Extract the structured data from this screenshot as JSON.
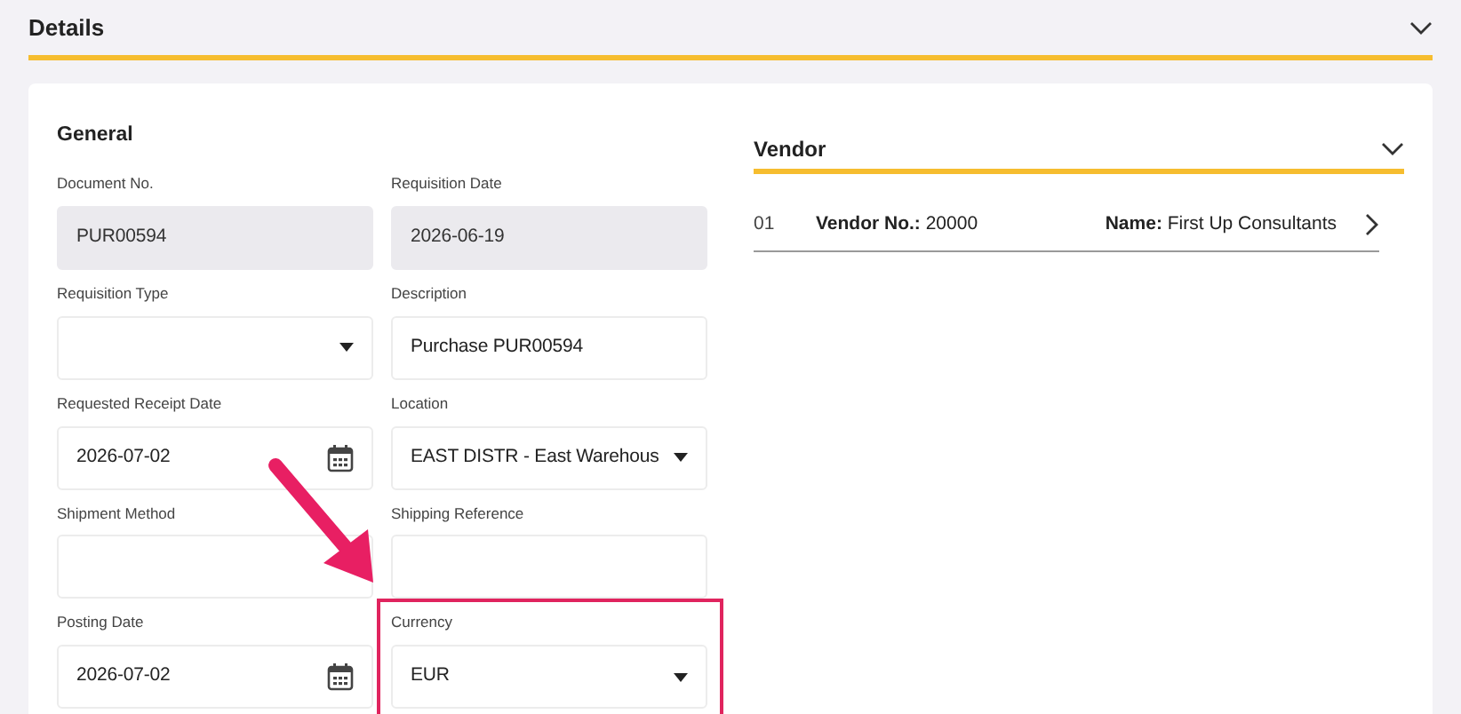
{
  "section": {
    "title": "Details",
    "expanded": true
  },
  "general": {
    "title": "General",
    "fields": [
      {
        "label": "Document No.",
        "kind": "readonly",
        "value": "PUR00594"
      },
      {
        "label": "Requisition Date",
        "kind": "readonly",
        "value": "2026-06-19"
      },
      {
        "label": "Requisition Type",
        "kind": "select"
      },
      {
        "label": "Description",
        "kind": "text",
        "value": "Purchase PUR00594"
      },
      {
        "label": "Requested Receipt Date",
        "kind": "date",
        "value": "2026-07-02"
      },
      {
        "label": "Location",
        "kind": "select",
        "value": "EAST DISTR - East Warehous"
      },
      {
        "label": "Shipment Method",
        "kind": "text"
      },
      {
        "label": "Shipping Reference",
        "kind": "text"
      },
      {
        "label": "Posting Date",
        "kind": "date",
        "value": "2026-07-02"
      },
      {
        "label": "Currency",
        "kind": "select",
        "value": "EUR",
        "highlighted": true
      }
    ]
  },
  "vendor": {
    "title": "Vendor",
    "expanded": true,
    "rows": [
      {
        "index": "01",
        "vendor_no": "**Vendor No.:** 20000",
        "name": "**Name:** First Up Consultants"
      }
    ]
  }
}
